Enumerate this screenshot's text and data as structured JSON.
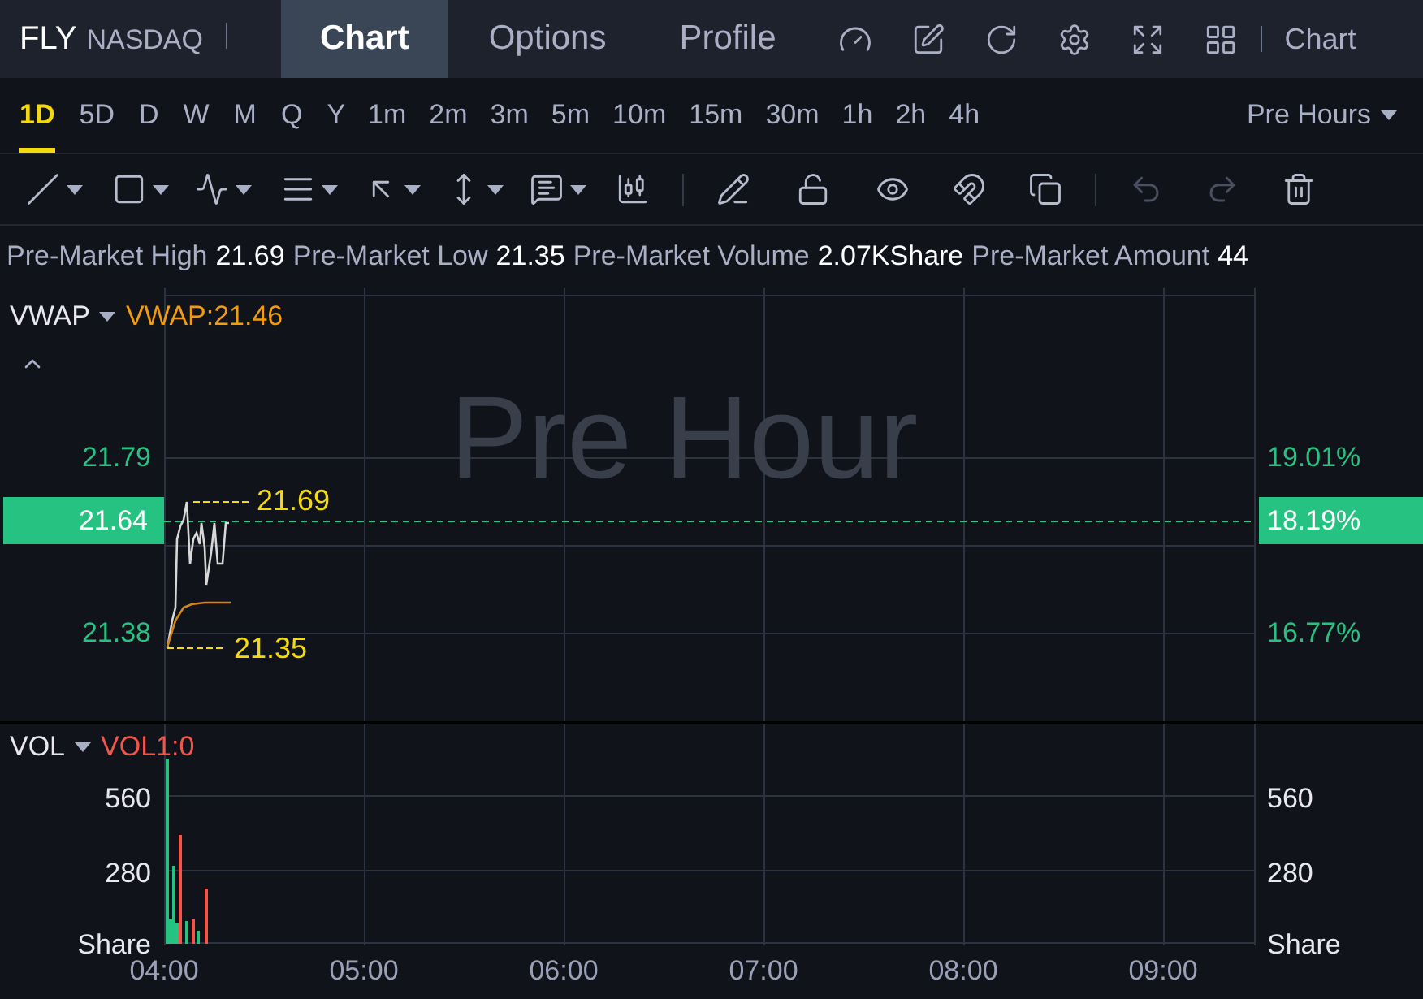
{
  "header": {
    "symbol": "FLY",
    "exchange": "NASDAQ",
    "tabs": [
      {
        "label": "Chart",
        "selected": true
      },
      {
        "label": "Options",
        "selected": false
      },
      {
        "label": "Profile",
        "selected": false
      }
    ],
    "right_label": "Chart"
  },
  "timeframes": [
    {
      "label": "1D",
      "selected": true
    },
    {
      "label": "5D",
      "selected": false
    },
    {
      "label": "D",
      "selected": false
    },
    {
      "label": "W",
      "selected": false
    },
    {
      "label": "M",
      "selected": false
    },
    {
      "label": "Q",
      "selected": false
    },
    {
      "label": "Y",
      "selected": false
    },
    {
      "label": "1m",
      "selected": false
    },
    {
      "label": "2m",
      "selected": false
    },
    {
      "label": "3m",
      "selected": false
    },
    {
      "label": "5m",
      "selected": false
    },
    {
      "label": "10m",
      "selected": false
    },
    {
      "label": "15m",
      "selected": false
    },
    {
      "label": "30m",
      "selected": false
    },
    {
      "label": "1h",
      "selected": false
    },
    {
      "label": "2h",
      "selected": false
    },
    {
      "label": "4h",
      "selected": false
    }
  ],
  "session": "Pre Hours",
  "stats": [
    {
      "label": "Pre-Market High",
      "value": "21.69"
    },
    {
      "label": "Pre-Market Low",
      "value": "21.35"
    },
    {
      "label": "Pre-Market Volume",
      "value": "2.07KShare"
    },
    {
      "label": "Pre-Market Amount",
      "value": "44"
    }
  ],
  "price_pane": {
    "indicator": "VWAP",
    "indicator_value": "VWAP:21.46",
    "watermark": "Pre Hour",
    "left_ticks": [
      "21.79",
      "21.38"
    ],
    "current_price": "21.64",
    "right_ticks": [
      "19.01%",
      "16.77%"
    ],
    "current_change": "18.19%",
    "high_marker": "21.69",
    "low_marker": "21.35"
  },
  "volume_pane": {
    "indicator": "VOL",
    "indicator_value": "VOL1:0",
    "left_ticks": [
      "560",
      "280",
      "Share"
    ],
    "right_ticks": [
      "560",
      "280",
      "Share"
    ]
  },
  "time_axis": [
    "04:00",
    "05:00",
    "06:00",
    "07:00",
    "08:00",
    "09:00"
  ]
}
